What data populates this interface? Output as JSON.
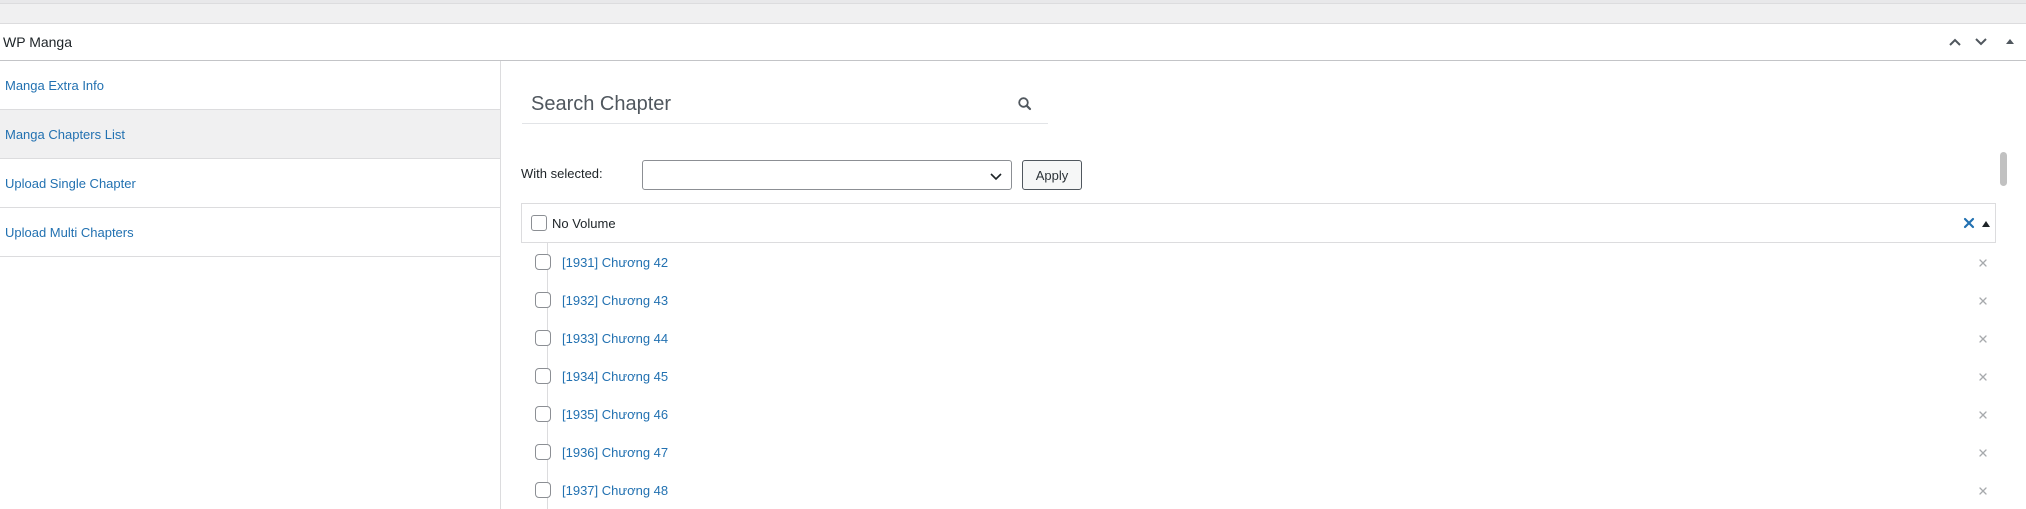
{
  "metabox": {
    "title": "WP Manga",
    "icons": [
      "chevron-up-icon",
      "chevron-down-icon",
      "triangle-up-icon"
    ]
  },
  "sidebar": {
    "items": [
      {
        "label": "Manga Extra Info",
        "active": false
      },
      {
        "label": "Manga Chapters List",
        "active": true
      },
      {
        "label": "Upload Single Chapter",
        "active": false
      },
      {
        "label": "Upload Multi Chapters",
        "active": false
      }
    ]
  },
  "search": {
    "placeholder": "Search Chapter",
    "value": "",
    "icon": "search-icon"
  },
  "bulk": {
    "label": "With selected:",
    "selected_value": "",
    "apply_label": "Apply"
  },
  "volume": {
    "name": "No Volume",
    "delete_icon": "close-icon",
    "toggle_icon": "triangle-up-icon"
  },
  "chapters": [
    {
      "label": "[1931] Chương 42"
    },
    {
      "label": "[1932] Chương 43"
    },
    {
      "label": "[1933] Chương 44"
    },
    {
      "label": "[1934] Chương 45"
    },
    {
      "label": "[1935] Chương 46"
    },
    {
      "label": "[1936] Chương 47"
    },
    {
      "label": "[1937] Chương 48"
    }
  ],
  "colors": {
    "link": "#2271b1",
    "active_bg": "#f0f0f1",
    "border": "#dcdcde",
    "volume_delete": "#2271b1"
  }
}
